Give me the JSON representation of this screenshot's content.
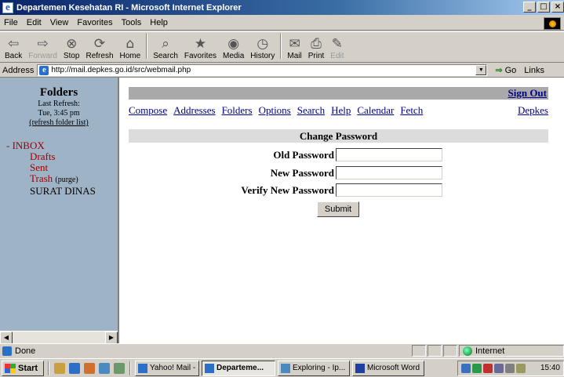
{
  "window": {
    "title": "Departemen Kesehatan RI - Microsoft Internet Explorer",
    "controls": [
      "_",
      "□",
      "×"
    ]
  },
  "menu": {
    "file": "File",
    "edit": "Edit",
    "view": "View",
    "favorites": "Favorites",
    "tools": "Tools",
    "help": "Help"
  },
  "toolbar": {
    "back": "Back",
    "forward": "Forward",
    "stop": "Stop",
    "refresh": "Refresh",
    "home": "Home",
    "search": "Search",
    "favorites": "Favorites",
    "media": "Media",
    "history": "History",
    "mail": "Mail",
    "print": "Print",
    "edit": "Edit"
  },
  "address": {
    "label": "Address",
    "url": "http://mail.depkes.go.id/src/webmail.php",
    "go": "Go",
    "links": "Links"
  },
  "sidebar": {
    "title": "Folders",
    "last_refresh_label": "Last Refresh:",
    "last_refresh_time": "Tue, 3:45 pm",
    "refresh_link": "(refresh folder list)",
    "inbox": "INBOX",
    "inbox_prefix": "-",
    "folders": {
      "drafts": "Drafts",
      "sent": "Sent",
      "trash": "Trash",
      "purge": "(purge)",
      "surat_dinas": "SURAT DINAS"
    }
  },
  "main": {
    "sign_out": "Sign Out",
    "nav": {
      "compose": "Compose",
      "addresses": "Addresses",
      "folders": "Folders",
      "options": "Options",
      "search": "Search",
      "help": "Help",
      "calendar": "Calendar",
      "fetch": "Fetch",
      "depkes": "Depkes"
    },
    "section_title": "Change Password",
    "old_password_label": "Old Password",
    "new_password_label": "New Password",
    "verify_password_label": "Verify New Password",
    "submit": "Submit"
  },
  "status": {
    "text": "Done",
    "zone": "Internet"
  },
  "taskbar": {
    "start": "Start",
    "tasks": {
      "yahoo": "Yahoo! Mail - ...",
      "depkes": "Departeme...",
      "exploring": "Exploring - Ip...",
      "word": "Microsoft Word"
    },
    "clock": "15:40"
  }
}
